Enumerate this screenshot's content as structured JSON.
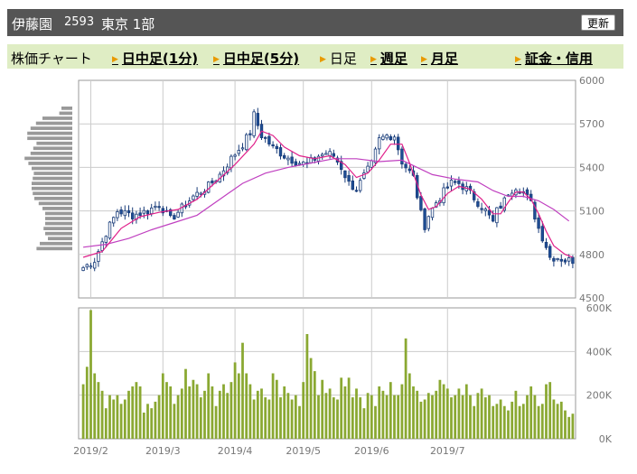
{
  "header": {
    "stock_name": "伊藤園",
    "code": "2593",
    "market": "東京 1部",
    "refresh_label": "更新"
  },
  "tabs": [
    {
      "label": "株価チャート",
      "link": false,
      "arrow": false
    },
    {
      "label": "日中足(1分)",
      "link": true,
      "arrow": true
    },
    {
      "label": "日中足(5分)",
      "link": true,
      "arrow": true
    },
    {
      "label": "日足",
      "link": false,
      "arrow": true
    },
    {
      "label": "週足",
      "link": true,
      "arrow": true
    },
    {
      "label": "月足",
      "link": true,
      "arrow": true
    },
    {
      "label": "証金・信用",
      "link": true,
      "arrow": true
    }
  ],
  "colors": {
    "up_candle": "#ffffff",
    "down_candle": "#1e4e96",
    "ma_short": "#e0208a",
    "ma_long": "#c040c0",
    "volume_bar": "#8aa832",
    "volume_profile": "#999999",
    "grid": "#cccccc"
  },
  "chart_data": [
    {
      "type": "candlestick",
      "title": "",
      "ylim": [
        4500,
        6000
      ],
      "y_ticks": [
        "4500",
        "4800",
        "5100",
        "5400",
        "5700",
        "6000"
      ],
      "x_ticks": [
        "2019/2",
        "2019/3",
        "2019/4",
        "2019/5",
        "2019/6",
        "2019/7"
      ],
      "close_path": [
        [
          0,
          4710
        ],
        [
          3,
          4760
        ],
        [
          6,
          4950
        ],
        [
          9,
          5100
        ],
        [
          13,
          5070
        ],
        [
          17,
          5100
        ],
        [
          20,
          5150
        ],
        [
          23,
          5040
        ],
        [
          26,
          5120
        ],
        [
          29,
          5200
        ],
        [
          33,
          5270
        ],
        [
          36,
          5350
        ],
        [
          39,
          5460
        ],
        [
          42,
          5560
        ],
        [
          44,
          5640
        ],
        [
          45,
          5760
        ],
        [
          47,
          5620
        ],
        [
          50,
          5540
        ],
        [
          53,
          5480
        ],
        [
          56,
          5440
        ],
        [
          59,
          5420
        ],
        [
          62,
          5480
        ],
        [
          64,
          5500
        ],
        [
          66,
          5480
        ],
        [
          68,
          5400
        ],
        [
          70,
          5290
        ],
        [
          72,
          5250
        ],
        [
          74,
          5340
        ],
        [
          76,
          5420
        ],
        [
          78,
          5590
        ],
        [
          80,
          5620
        ],
        [
          82,
          5620
        ],
        [
          84,
          5440
        ],
        [
          87,
          5330
        ],
        [
          89,
          5080
        ],
        [
          90,
          5000
        ],
        [
          91,
          5070
        ],
        [
          93,
          5160
        ],
        [
          95,
          5230
        ],
        [
          97,
          5290
        ],
        [
          99,
          5290
        ],
        [
          101,
          5250
        ],
        [
          103,
          5190
        ],
        [
          106,
          5100
        ],
        [
          108,
          5020
        ],
        [
          109,
          5100
        ],
        [
          111,
          5170
        ],
        [
          112,
          5230
        ],
        [
          114,
          5270
        ],
        [
          116,
          5230
        ],
        [
          118,
          5150
        ],
        [
          120,
          4980
        ],
        [
          122,
          4860
        ],
        [
          123,
          4780
        ],
        [
          125,
          4780
        ],
        [
          127,
          4760
        ],
        [
          129,
          4760
        ]
      ],
      "ma_short_path": [
        [
          0,
          4780
        ],
        [
          5,
          4820
        ],
        [
          10,
          4980
        ],
        [
          15,
          5060
        ],
        [
          20,
          5090
        ],
        [
          25,
          5110
        ],
        [
          30,
          5180
        ],
        [
          35,
          5300
        ],
        [
          40,
          5420
        ],
        [
          45,
          5560
        ],
        [
          47,
          5650
        ],
        [
          50,
          5620
        ],
        [
          53,
          5540
        ],
        [
          57,
          5480
        ],
        [
          61,
          5460
        ],
        [
          65,
          5480
        ],
        [
          69,
          5420
        ],
        [
          72,
          5330
        ],
        [
          75,
          5360
        ],
        [
          78,
          5450
        ],
        [
          81,
          5560
        ],
        [
          84,
          5560
        ],
        [
          86,
          5430
        ],
        [
          89,
          5210
        ],
        [
          91,
          5110
        ],
        [
          93,
          5130
        ],
        [
          96,
          5220
        ],
        [
          99,
          5270
        ],
        [
          102,
          5250
        ],
        [
          105,
          5180
        ],
        [
          108,
          5080
        ],
        [
          110,
          5080
        ],
        [
          112,
          5160
        ],
        [
          114,
          5230
        ],
        [
          116,
          5230
        ],
        [
          118,
          5180
        ],
        [
          120,
          5080
        ],
        [
          122,
          4960
        ],
        [
          124,
          4860
        ],
        [
          127,
          4800
        ],
        [
          129,
          4780
        ]
      ],
      "ma_long_path": [
        [
          0,
          4850
        ],
        [
          6,
          4870
        ],
        [
          12,
          4910
        ],
        [
          18,
          4970
        ],
        [
          24,
          5020
        ],
        [
          30,
          5070
        ],
        [
          36,
          5180
        ],
        [
          42,
          5290
        ],
        [
          48,
          5360
        ],
        [
          54,
          5400
        ],
        [
          60,
          5430
        ],
        [
          66,
          5460
        ],
        [
          72,
          5460
        ],
        [
          78,
          5440
        ],
        [
          84,
          5450
        ],
        [
          88,
          5400
        ],
        [
          92,
          5350
        ],
        [
          98,
          5320
        ],
        [
          104,
          5300
        ],
        [
          108,
          5240
        ],
        [
          112,
          5200
        ],
        [
          116,
          5200
        ],
        [
          120,
          5170
        ],
        [
          124,
          5110
        ],
        [
          128,
          5030
        ]
      ],
      "volume_profile": [
        0.2,
        0.24,
        0.55,
        0.67,
        0.77,
        0.83,
        0.83,
        0.66,
        0.72,
        0.77,
        0.88,
        0.81,
        0.75,
        0.71,
        0.73,
        0.75,
        0.75,
        0.73,
        0.7,
        0.62,
        0.55,
        0.5,
        0.5,
        0.5,
        0.53,
        0.5,
        0.45,
        0.6,
        0.66
      ]
    },
    {
      "type": "bar",
      "series": [
        {
          "values": [
            250,
            330,
            590,
            300,
            260,
            220,
            140,
            200,
            180,
            200,
            160,
            180,
            220,
            240,
            260,
            240,
            120,
            160,
            140,
            170,
            200,
            300,
            260,
            240,
            160,
            200,
            230,
            320,
            240,
            270,
            250,
            190,
            220,
            300,
            240,
            150,
            220,
            250,
            210,
            260,
            350,
            300,
            440,
            300,
            250,
            180,
            220,
            230,
            190,
            180,
            300,
            270,
            190,
            240,
            210,
            180,
            200,
            150,
            260,
            480,
            370,
            310,
            200,
            270,
            210,
            230,
            190,
            180,
            280,
            240,
            280,
            190,
            230,
            190,
            140,
            210,
            200,
            150,
            240,
            220,
            200,
            260,
            200,
            200,
            250,
            460,
            300,
            240,
            220,
            170,
            180,
            210,
            200,
            220,
            270,
            250,
            230,
            190,
            200,
            230,
            200,
            250,
            200,
            150,
            210,
            230,
            190,
            200,
            150,
            160,
            180,
            150,
            130,
            170,
            220,
            150,
            160,
            200,
            240,
            200,
            150,
            160,
            250,
            260,
            180,
            160,
            170,
            130,
            100,
            115
          ]
        }
      ],
      "ylim": [
        0,
        600000
      ],
      "y_ticks": [
        "0K",
        "200K",
        "400K",
        "600K"
      ]
    }
  ]
}
